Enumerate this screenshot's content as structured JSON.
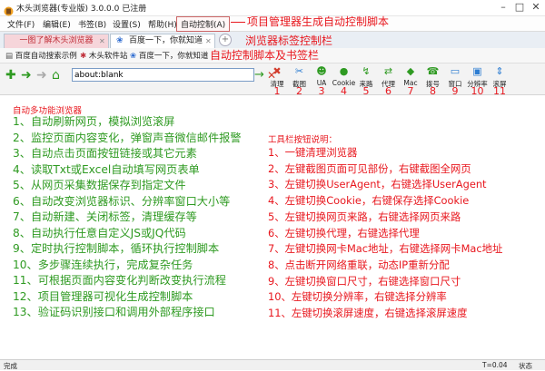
{
  "window": {
    "title": "木头浏览器(专业版) 3.0.0.0  已注册"
  },
  "menu": [
    {
      "label": "文件(F)"
    },
    {
      "label": "编辑(E)"
    },
    {
      "label": "书签(B)"
    },
    {
      "label": "设置(S)"
    },
    {
      "label": "帮助(H)"
    },
    {
      "label": "自动控制(A)"
    }
  ],
  "annotations": {
    "menu": "项目管理器生成自动控制脚本",
    "tabs": "浏览器标签控制栏",
    "bookmarks": "自动控制脚本及书签栏"
  },
  "tabs": [
    {
      "label": "一图了解木头浏览器"
    },
    {
      "label": "百度一下，你就知道"
    }
  ],
  "bookmarks": [
    {
      "label": "百度自动搜索示例"
    },
    {
      "label": "木头软件站"
    },
    {
      "label": "百度一下，你就知道"
    }
  ],
  "address": {
    "value": "about:blank"
  },
  "toolbar": [
    {
      "label": "清理",
      "icon": "broom-icon",
      "color": "#d23b2b",
      "num": "1"
    },
    {
      "label": "截图",
      "icon": "scissors-icon",
      "color": "#2d7dd2",
      "num": "2"
    },
    {
      "label": "UA",
      "icon": "user-agent-icon",
      "color": "#2e9a21",
      "num": "3"
    },
    {
      "label": "Cookie",
      "icon": "cookie-icon",
      "color": "#2e9a21",
      "num": "4"
    },
    {
      "label": "来路",
      "icon": "source-icon",
      "color": "#2e9a21",
      "num": "5"
    },
    {
      "label": "代理",
      "icon": "proxy-icon",
      "color": "#2e9a21",
      "num": "6"
    },
    {
      "label": "Mac",
      "icon": "mac-icon",
      "color": "#2e9a21",
      "num": "7"
    },
    {
      "label": "拨号",
      "icon": "dial-icon",
      "color": "#2e9a21",
      "num": "8"
    },
    {
      "label": "窗口",
      "icon": "window-icon",
      "color": "#2d7dd2",
      "num": "9"
    },
    {
      "label": "分辨率",
      "icon": "resolution-icon",
      "color": "#2d7dd2",
      "num": "10"
    },
    {
      "label": "滚屏",
      "icon": "scroll-icon",
      "color": "#2d7dd2",
      "num": "11"
    }
  ],
  "content": {
    "left_title": "自动多功能浏览器",
    "features": [
      "1、自动刷新网页，模拟浏览滚屏",
      "2、监控页面内容变化，弹窗声音微信邮件报警",
      "3、自动点击页面按钮链接或其它元素",
      "4、读取Txt或Excel自动填写网页表单",
      "5、从网页采集数据保存到指定文件",
      "6、自动改变浏览器标识、分辨率窗口大小等",
      "7、自动新建、关闭标签，清理缓存等",
      "8、自动执行任意自定义JS或JQ代码",
      "9、定时执行控制脚本，循环执行控制脚本",
      "10、多步骤连续执行，完成复杂任务",
      "11、可根据页面内容变化判断改变执行流程",
      "12、项目管理器可视化生成控制脚本",
      "13、验证码识别接口和调用外部程序接口"
    ],
    "right_title": "工具栏按钮说明：",
    "buttons_help": [
      "1、一键清理浏览器",
      "2、左键截图页面可见部份，右键截图全网页",
      "3、左键切换UserAgent，右键选择UserAgent",
      "4、左键切换Cookie，右键保存选择Cookie",
      "5、左键切换网页来路，右键选择网页来路",
      "6、左键切换代理，右键选择代理",
      "7、左键切换网卡Mac地址，右键选择网卡Mac地址",
      "8、点击断开网络重联，动态IP重新分配",
      "9、左键切换窗口尺寸，右键选择窗口尺寸",
      "10、左键切换分辨率，右键选择分辨率",
      "11、左键切换滚屏速度，右键选择滚屏速度"
    ]
  },
  "status": {
    "left": "完成",
    "timer": "T=0.04",
    "right": "状态"
  }
}
